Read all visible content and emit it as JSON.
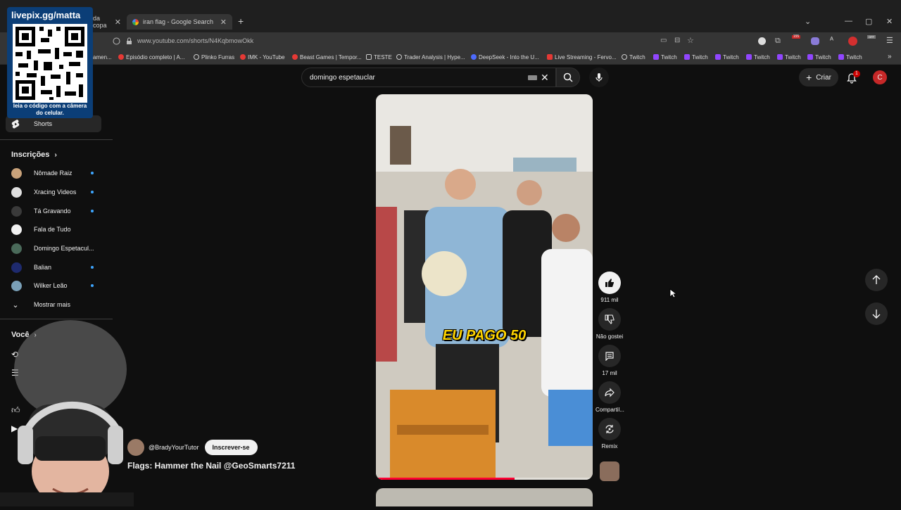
{
  "browser": {
    "tabs": [
      {
        "title": "da copa"
      },
      {
        "title": "iran flag - Google Search"
      }
    ],
    "new_tab": "+",
    "url": "www.youtube.com/shorts/N4KqbmowOkk",
    "extension_badge": "155",
    "off_badge": "OFF",
    "bookmarks": [
      {
        "label": "amen..."
      },
      {
        "label": "Episódio completo | A..."
      },
      {
        "label": "Plinko Furras"
      },
      {
        "label": "IMK - YouTube"
      },
      {
        "label": "Beast Games | Tempor..."
      },
      {
        "label": "TESTE"
      },
      {
        "label": "Trader Analysis | Hype..."
      },
      {
        "label": "DeepSeek - Into the U..."
      },
      {
        "label": "Live Streaming - Fervo..."
      },
      {
        "label": "Twitch"
      },
      {
        "label": "Twitch"
      },
      {
        "label": "Twitch"
      },
      {
        "label": "Twitch"
      },
      {
        "label": "Twitch"
      },
      {
        "label": "Twitch"
      },
      {
        "label": "Twitch"
      }
    ]
  },
  "overlay": {
    "qr_title": "livepix.gg/matta",
    "qr_caption": "leia o código com a câmera do celular."
  },
  "sidebar": {
    "shorts_label": "Shorts",
    "subscriptions_header": "Inscrições",
    "subscriptions": [
      {
        "label": "Nômade Raiz",
        "new": true,
        "color": "#c9a27a"
      },
      {
        "label": "Xracing Videos",
        "new": true,
        "color": "#e0e0e0"
      },
      {
        "label": "Tá Gravando",
        "new": true,
        "color": "#3a3a3a"
      },
      {
        "label": "Fala de Tudo",
        "new": false,
        "color": "#f1f1f1"
      },
      {
        "label": "Domingo Espetacul...",
        "new": false,
        "color": "#4a6a5a"
      },
      {
        "label": "Balian",
        "new": true,
        "color": "#1e2a6e"
      },
      {
        "label": "Wilker Leão",
        "new": true,
        "color": "#7aa0b8"
      }
    ],
    "show_more": "Mostrar mais",
    "you_header": "Você"
  },
  "header": {
    "search_value": "domingo espetauclar",
    "create_label": "Criar",
    "notifications_count": "1",
    "account_initial": "C"
  },
  "short": {
    "caption": "EU PAGO 50",
    "progress": 0.64,
    "channel_handle": "@BradyYourTutor",
    "subscribe_label": "Inscrever-se",
    "title": "Flags: Hammer the Nail @GeoSmarts7211",
    "actions": {
      "likes": "911 mil",
      "dislike": "Não gostei",
      "comments": "17 mil",
      "share": "Compartil...",
      "remix": "Remix"
    }
  }
}
